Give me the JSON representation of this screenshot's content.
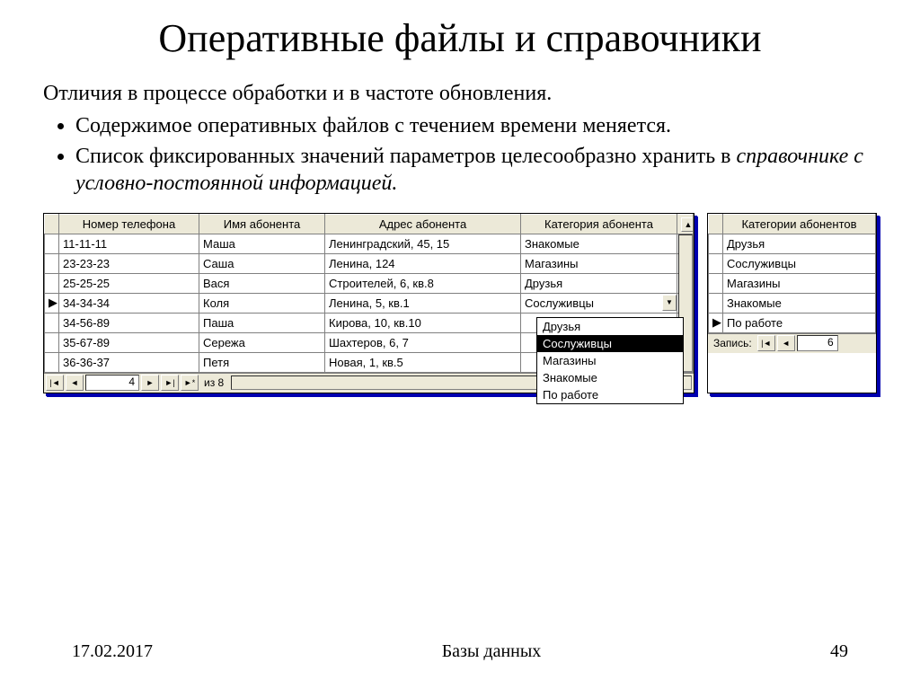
{
  "title": "Оперативные файлы и справочники",
  "intro": "Отличия в процессе обработки и в частоте обновления.",
  "bullets": [
    {
      "pre": "Содержимое оперативных файлов с течением времени меняется.",
      "italic": ""
    },
    {
      "pre": "Список фиксированных значений параметров целесообразно хранить в ",
      "italic": "справочнике с условно-постоянной информацией."
    }
  ],
  "left_table": {
    "headers": [
      "Номер телефона",
      "Имя абонента",
      "Адрес абонента",
      "Категория абонента"
    ],
    "rows": [
      [
        "11-11-11",
        "Маша",
        "Ленинградский, 45, 15",
        "Знакомые"
      ],
      [
        "23-23-23",
        "Саша",
        "Ленина, 124",
        "Магазины"
      ],
      [
        "25-25-25",
        "Вася",
        "Строителей, 6, кв.8",
        "Друзья"
      ],
      [
        "34-34-34",
        "Коля",
        "Ленина, 5, кв.1",
        "Сослуживцы"
      ],
      [
        "34-56-89",
        "Паша",
        "Кирова, 10, кв.10",
        ""
      ],
      [
        "35-67-89",
        "Сережа",
        "Шахтеров, 6, 7",
        ""
      ],
      [
        "36-36-37",
        "Петя",
        "Новая, 1, кв.5",
        ""
      ]
    ],
    "dropdown_row_index": 3,
    "nav_current": "4",
    "nav_total": "из  8"
  },
  "dropdown_options": [
    "Друзья",
    "Сослуживцы",
    "Магазины",
    "Знакомые",
    "По работе"
  ],
  "dropdown_selected_index": 1,
  "right_table": {
    "header": "Категории абонентов",
    "rows": [
      "Друзья",
      "Сослуживцы",
      "Магазины",
      "Знакомые",
      "По работе"
    ],
    "nav_label": "Запись:",
    "nav_current": "6"
  },
  "footer": {
    "date": "17.02.2017",
    "subject": "Базы данных",
    "page": "49"
  },
  "nav_icons": {
    "first": "|◄",
    "prev": "◄",
    "next": "►",
    "last": "►|",
    "new": "►*"
  }
}
